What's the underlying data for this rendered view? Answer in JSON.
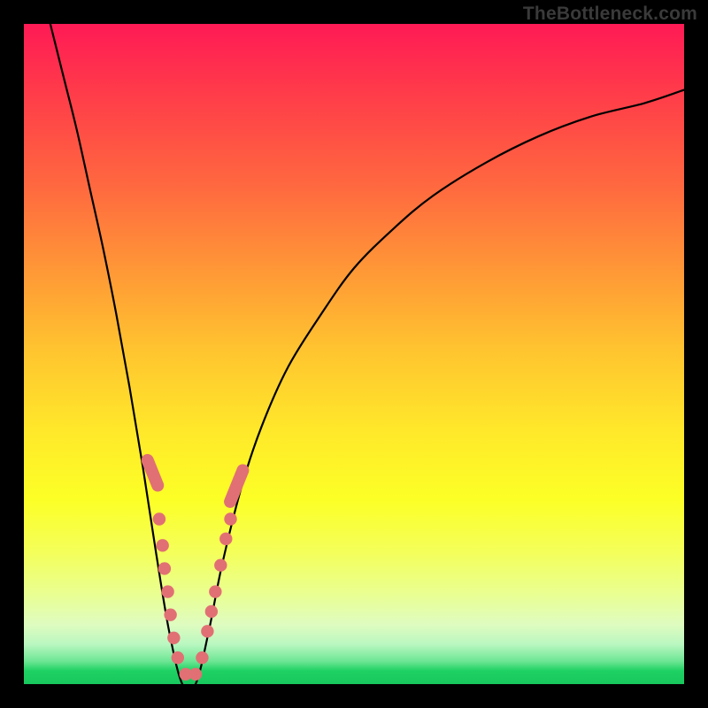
{
  "watermark": "TheBottleneck.com",
  "colors": {
    "frame": "#000000",
    "curve": "#000000",
    "marker": "#e17074"
  },
  "chart_data": {
    "type": "line",
    "title": "",
    "xlabel": "",
    "ylabel": "",
    "xlim": [
      0,
      100
    ],
    "ylim": [
      0,
      100
    ],
    "grid": false,
    "legend": false,
    "axes_visible": false,
    "description": "V-shaped bottleneck curve over a vertical heat gradient (red=high, green=low). Minimum near x≈24 at y≈0. Left branch rises from (~24,0) to top-left corner; right branch rises asymptotically toward ~y=90 at x=100.",
    "curve_points": [
      {
        "x": 4,
        "y": 100
      },
      {
        "x": 6,
        "y": 92
      },
      {
        "x": 8,
        "y": 84
      },
      {
        "x": 10,
        "y": 75
      },
      {
        "x": 12,
        "y": 66
      },
      {
        "x": 14,
        "y": 56
      },
      {
        "x": 16,
        "y": 45
      },
      {
        "x": 18,
        "y": 33
      },
      {
        "x": 20,
        "y": 20
      },
      {
        "x": 22,
        "y": 8
      },
      {
        "x": 24,
        "y": 0
      },
      {
        "x": 26,
        "y": 0
      },
      {
        "x": 28,
        "y": 8
      },
      {
        "x": 30,
        "y": 18
      },
      {
        "x": 33,
        "y": 30
      },
      {
        "x": 36,
        "y": 39
      },
      {
        "x": 40,
        "y": 48
      },
      {
        "x": 45,
        "y": 56
      },
      {
        "x": 50,
        "y": 63
      },
      {
        "x": 56,
        "y": 69
      },
      {
        "x": 62,
        "y": 74
      },
      {
        "x": 70,
        "y": 79
      },
      {
        "x": 78,
        "y": 83
      },
      {
        "x": 86,
        "y": 86
      },
      {
        "x": 94,
        "y": 88
      },
      {
        "x": 100,
        "y": 90
      }
    ],
    "markers_left": [
      {
        "x": 19.5,
        "y": 32,
        "pill": true,
        "len": 6
      },
      {
        "x": 20.5,
        "y": 25
      },
      {
        "x": 21.0,
        "y": 21
      },
      {
        "x": 21.3,
        "y": 17.5
      },
      {
        "x": 21.8,
        "y": 14
      },
      {
        "x": 22.2,
        "y": 10.5
      },
      {
        "x": 22.7,
        "y": 7
      },
      {
        "x": 23.3,
        "y": 4
      },
      {
        "x": 24.5,
        "y": 1.5
      }
    ],
    "markers_right": [
      {
        "x": 26.0,
        "y": 1.5
      },
      {
        "x": 27.0,
        "y": 4
      },
      {
        "x": 27.8,
        "y": 8
      },
      {
        "x": 28.4,
        "y": 11
      },
      {
        "x": 29.0,
        "y": 14
      },
      {
        "x": 29.8,
        "y": 18
      },
      {
        "x": 30.6,
        "y": 22
      },
      {
        "x": 31.3,
        "y": 25
      },
      {
        "x": 32.2,
        "y": 30,
        "pill": true,
        "len": 7
      }
    ]
  }
}
